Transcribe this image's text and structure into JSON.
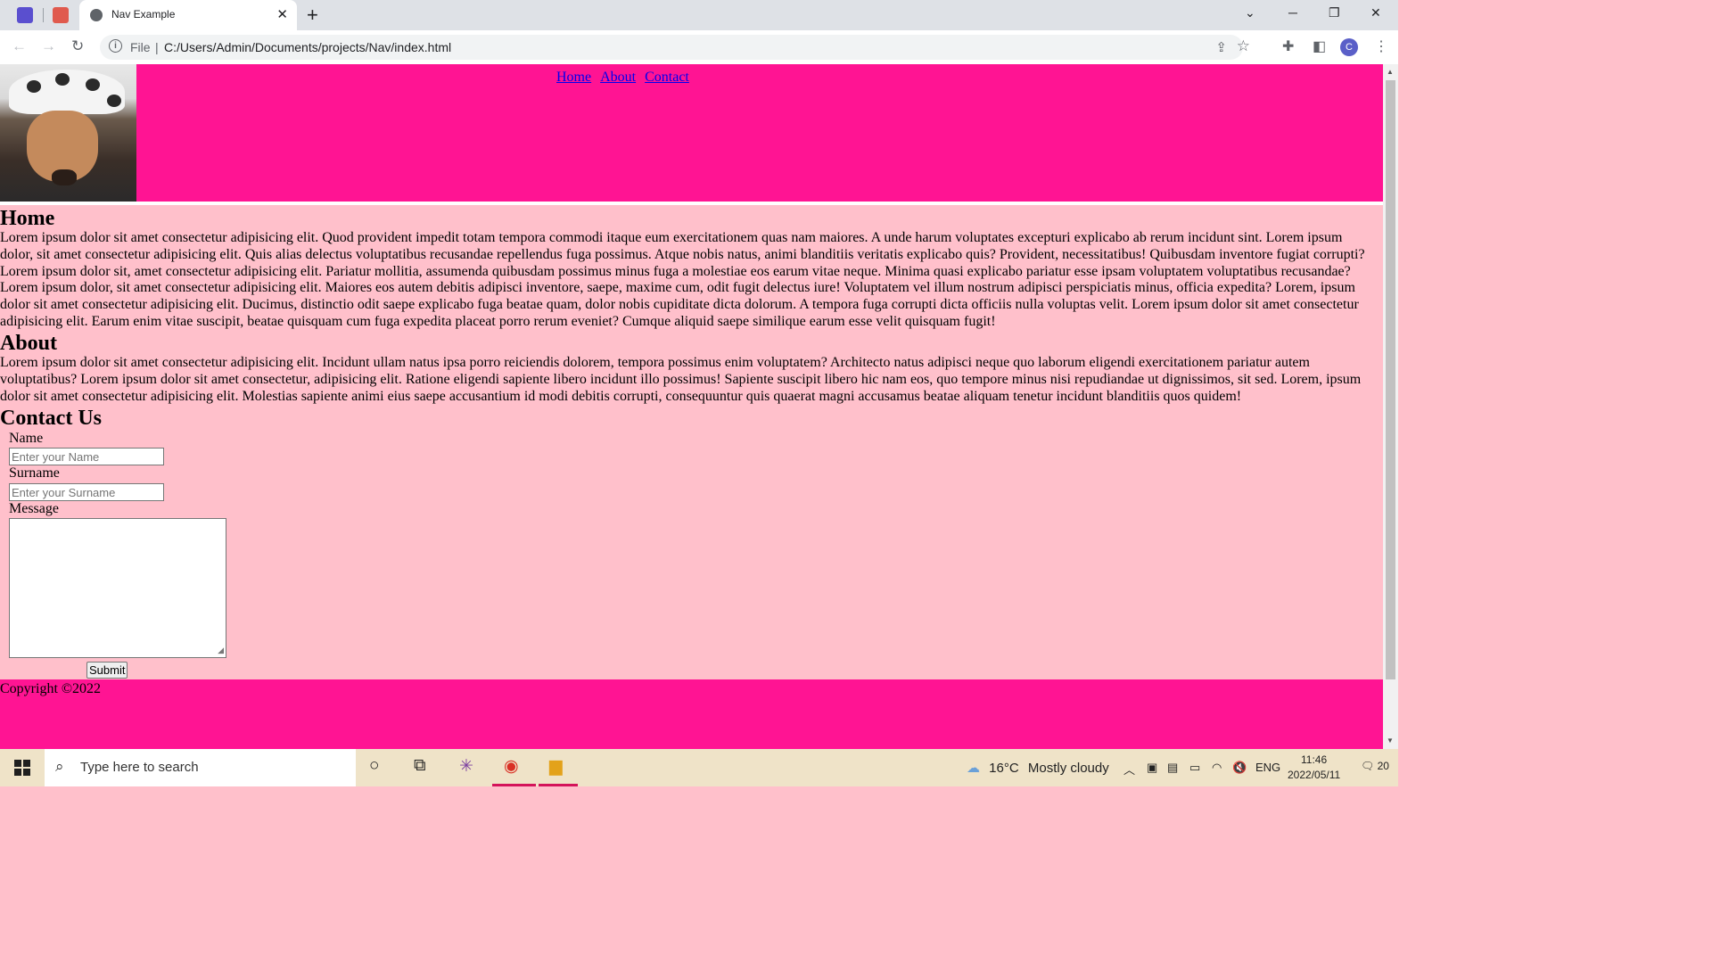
{
  "browser": {
    "tab_title": "Nav Example",
    "url_scheme": "File",
    "url": "C:/Users/Admin/Documents/projects/Nav/index.html",
    "profile_initial": "C"
  },
  "site": {
    "nav": [
      "Home",
      "About",
      "Contact"
    ],
    "home": {
      "title": "Home",
      "text": "Lorem ipsum dolor sit amet consectetur adipisicing elit. Quod provident impedit totam tempora commodi itaque eum exercitationem quas nam maiores. A unde harum voluptates excepturi explicabo ab rerum incidunt sint. Lorem ipsum dolor, sit amet consectetur adipisicing elit. Quis alias delectus voluptatibus recusandae repellendus fuga possimus. Atque nobis natus, animi blanditiis veritatis explicabo quis? Provident, necessitatibus! Quibusdam inventore fugiat corrupti? Lorem ipsum dolor sit, amet consectetur adipisicing elit. Pariatur mollitia, assumenda quibusdam possimus minus fuga a molestiae eos earum vitae neque. Minima quasi explicabo pariatur esse ipsam voluptatem voluptatibus recusandae? Lorem ipsum dolor, sit amet consectetur adipisicing elit. Maiores eos autem debitis adipisci inventore, saepe, maxime cum, odit fugit delectus iure! Voluptatem vel illum nostrum adipisci perspiciatis minus, officia expedita? Lorem, ipsum dolor sit amet consectetur adipisicing elit. Ducimus, distinctio odit saepe explicabo fuga beatae quam, dolor nobis cupiditate dicta dolorum. A tempora fuga corrupti dicta officiis nulla voluptas velit. Lorem ipsum dolor sit amet consectetur adipisicing elit. Earum enim vitae suscipit, beatae quisquam cum fuga expedita placeat porro rerum eveniet? Cumque aliquid saepe similique earum esse velit quisquam fugit!"
    },
    "about": {
      "title": "About",
      "text": "Lorem ipsum dolor sit amet consectetur adipisicing elit. Incidunt ullam natus ipsa porro reiciendis dolorem, tempora possimus enim voluptatem? Architecto natus adipisci neque quo laborum eligendi exercitationem pariatur autem voluptatibus? Lorem ipsum dolor sit amet consectetur, adipisicing elit. Ratione eligendi sapiente libero incidunt illo possimus! Sapiente suscipit libero hic nam eos, quo tempore minus nisi repudiandae ut dignissimos, sit sed. Lorem, ipsum dolor sit amet consectetur adipisicing elit. Molestias sapiente animi eius saepe accusantium id modi debitis corrupti, consequuntur quis quaerat magni accusamus beatae aliquam tenetur incidunt blanditiis quos quidem!"
    },
    "contact": {
      "title": "Contact Us",
      "name_label": "Name",
      "name_placeholder": "Enter your Name",
      "surname_label": "Surname",
      "surname_placeholder": "Enter your Surname",
      "message_label": "Message",
      "submit_label": "Submit"
    },
    "footer": {
      "copyright": "Copyright ©2022"
    },
    "colors": {
      "header_bg": "#ff1493",
      "page_bg": "#ffc0cb",
      "link": "#0000ee"
    }
  },
  "taskbar": {
    "search_placeholder": "Type here to search",
    "temperature": "16°C",
    "weather": "Mostly cloudy",
    "language": "ENG",
    "time": "11:46",
    "date": "2022/05/11",
    "notifications": "20"
  }
}
